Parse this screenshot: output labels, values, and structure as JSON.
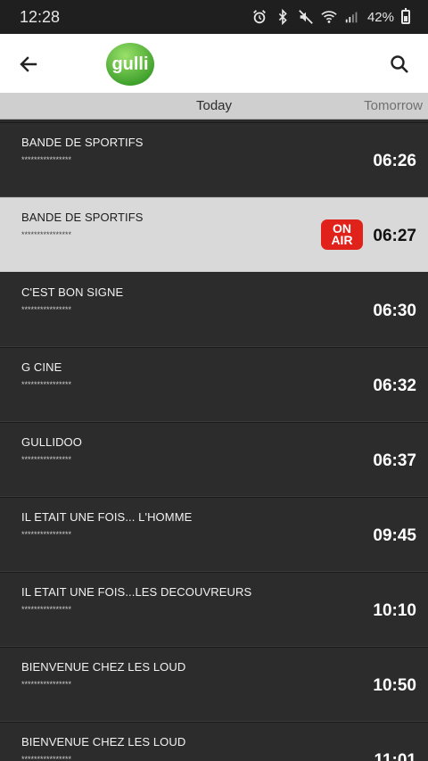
{
  "status_bar": {
    "time": "12:28",
    "battery_percent": "42%"
  },
  "header": {
    "logo_text": "gulli"
  },
  "tabs": {
    "today": "Today",
    "tomorrow": "Tomorrow"
  },
  "on_air": {
    "line1": "ON",
    "line2": "AIR"
  },
  "colors": {
    "on_air_red": "#e0221b",
    "logo_green": "#6cc04a"
  },
  "programs": [
    {
      "title": "BANDE DE SPORTIFS",
      "rating": "****************",
      "time": "06:26",
      "on_air": false
    },
    {
      "title": "BANDE DE SPORTIFS",
      "rating": "****************",
      "time": "06:27",
      "on_air": true
    },
    {
      "title": "C'EST BON SIGNE",
      "rating": "****************",
      "time": "06:30",
      "on_air": false
    },
    {
      "title": "G CINE",
      "rating": "****************",
      "time": "06:32",
      "on_air": false
    },
    {
      "title": "GULLIDOO",
      "rating": "****************",
      "time": "06:37",
      "on_air": false
    },
    {
      "title": "IL ETAIT UNE FOIS... L'HOMME",
      "rating": "****************",
      "time": "09:45",
      "on_air": false
    },
    {
      "title": "IL ETAIT UNE FOIS...LES DECOUVREURS",
      "rating": "****************",
      "time": "10:10",
      "on_air": false
    },
    {
      "title": "BIENVENUE CHEZ LES LOUD",
      "rating": "****************",
      "time": "10:50",
      "on_air": false
    },
    {
      "title": "BIENVENUE CHEZ LES LOUD",
      "rating": "****************",
      "time": "11:01",
      "on_air": false
    }
  ]
}
